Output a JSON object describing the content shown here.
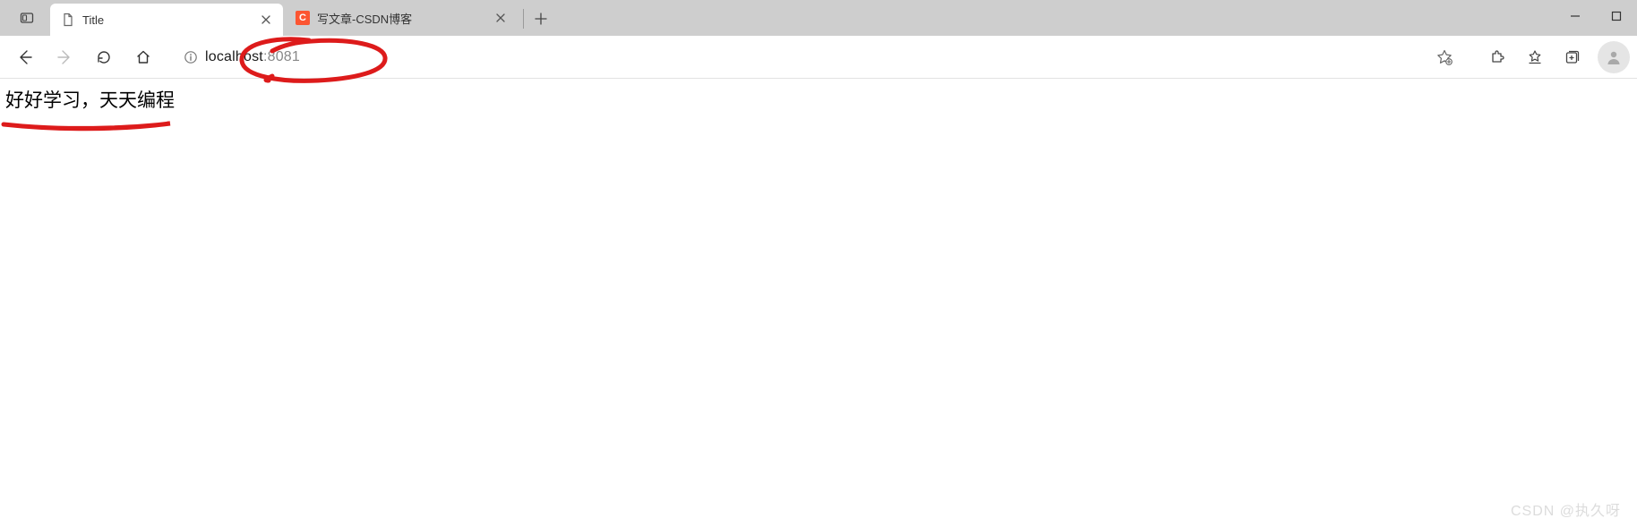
{
  "tabs": [
    {
      "label": "Title",
      "active": true
    },
    {
      "label": "写文章-CSDN博客",
      "active": false,
      "favicon": "C"
    }
  ],
  "address": {
    "host": "localhost",
    "port": ":8081"
  },
  "page": {
    "body_text": "好好学习，天天编程"
  },
  "watermark": "CSDN @执久呀"
}
